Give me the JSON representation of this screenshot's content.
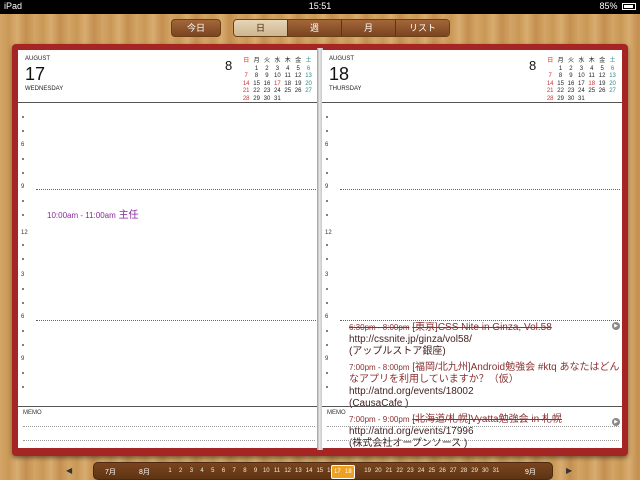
{
  "status": {
    "device": "iPad",
    "time": "15:51",
    "battery": "85%"
  },
  "toolbar": {
    "today": "今日",
    "views": [
      {
        "label": "日",
        "active": true
      },
      {
        "label": "週",
        "active": false
      },
      {
        "label": "月",
        "active": false
      },
      {
        "label": "リスト",
        "active": false
      }
    ]
  },
  "mini_calendar": {
    "month_num": "8",
    "headers": [
      "日",
      "月",
      "火",
      "水",
      "木",
      "金",
      "土"
    ],
    "weeks": [
      [
        "",
        "1",
        "2",
        "3",
        "4",
        "5",
        "6"
      ],
      [
        "7",
        "8",
        "9",
        "10",
        "11",
        "12",
        "13"
      ],
      [
        "14",
        "15",
        "16",
        "17",
        "18",
        "19",
        "20"
      ],
      [
        "21",
        "22",
        "23",
        "24",
        "25",
        "26",
        "27"
      ],
      [
        "28",
        "29",
        "30",
        "31",
        "",
        "",
        ""
      ]
    ]
  },
  "left_page": {
    "month": "AUGUST",
    "day": "17",
    "weekday": "WEDNESDAY",
    "hour_labels": {
      "six": "6",
      "nine": "9",
      "twelve": "12",
      "three": "3"
    },
    "event": {
      "time": "10:00am - 11:00am",
      "title": "主任"
    },
    "memo": "MEMO"
  },
  "right_page": {
    "month": "AUGUST",
    "day": "18",
    "weekday": "THURSDAY",
    "hour_labels": {
      "six": "6",
      "nine": "9",
      "twelve": "12",
      "three": "3"
    },
    "memo": "MEMO",
    "events": [
      {
        "time": "6:30pm - 8:00pm",
        "title": "[東京]CSS Nite in Ginza, Vol.58",
        "url": "http://cssnite.jp/ginza/vol58/",
        "place": "(アップルストア銀座)"
      },
      {
        "time": "7:00pm - 8:00pm",
        "title": "[福岡/北九州]Android勉強会 #ktq あなたはどんなアプリを利用していますか？（仮）",
        "url": "http://atnd.org/events/18002",
        "place": "(CausaCafe )"
      },
      {
        "time": "7:00pm - 9:00pm",
        "title": "[北海道/札幌]Vyatta勉強会 in 札幌",
        "url": "http://atnd.org/events/17996",
        "place": "(株式会社オープンソース )"
      }
    ]
  },
  "timeline": {
    "prev_month": "7月",
    "current_month": "8月",
    "next_month": "9月",
    "days": [
      "1",
      "2",
      "3",
      "4",
      "5",
      "6",
      "7",
      "8",
      "9",
      "10",
      "11",
      "12",
      "13",
      "14",
      "15",
      "16",
      "17",
      "18",
      "19",
      "20",
      "21",
      "22",
      "23",
      "24",
      "25",
      "26",
      "27",
      "28",
      "29",
      "30",
      "31"
    ],
    "selected": [
      "17",
      "18"
    ]
  }
}
